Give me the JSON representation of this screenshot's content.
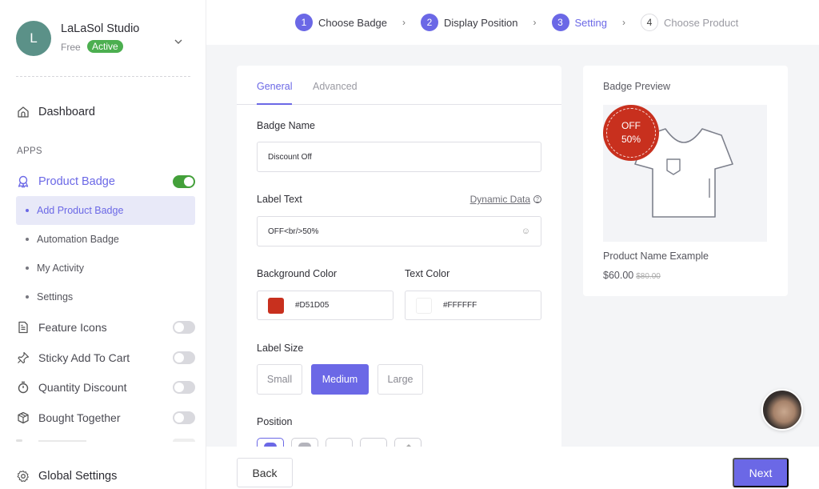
{
  "account": {
    "initial": "L",
    "name": "LaLaSol Studio",
    "plan": "Free",
    "status": "Active"
  },
  "sidebar": {
    "dashboard": "Dashboard",
    "apps_heading": "APPS",
    "product_badge": {
      "label": "Product Badge",
      "enabled": true
    },
    "sub_items": [
      {
        "label": "Add Product Badge",
        "active": true
      },
      {
        "label": "Automation Badge",
        "active": false
      },
      {
        "label": "My Activity",
        "active": false
      },
      {
        "label": "Settings",
        "active": false
      }
    ],
    "apps": [
      {
        "label": "Feature Icons",
        "icon": "file-icon",
        "enabled": false
      },
      {
        "label": "Sticky Add To Cart",
        "icon": "pin-icon",
        "enabled": false
      },
      {
        "label": "Quantity Discount",
        "icon": "stopwatch-icon",
        "enabled": false
      },
      {
        "label": "Bought Together",
        "icon": "box-icon",
        "enabled": false
      }
    ],
    "global_settings": "Global Settings"
  },
  "stepper": {
    "steps": [
      {
        "num": "1",
        "label": "Choose Badge",
        "state": "done"
      },
      {
        "num": "2",
        "label": "Display Position",
        "state": "done"
      },
      {
        "num": "3",
        "label": "Setting",
        "state": "current"
      },
      {
        "num": "4",
        "label": "Choose Product",
        "state": "pending"
      }
    ],
    "separator": "›"
  },
  "settings": {
    "tabs": {
      "general": "General",
      "advanced": "Advanced",
      "active": "General"
    },
    "badge_name": {
      "label": "Badge Name",
      "value": "Discount Off"
    },
    "label_text": {
      "label": "Label Text",
      "value": "OFF<br/>50%",
      "dynamic_link": "Dynamic Data",
      "help": "?",
      "emoji": "☺"
    },
    "background_color": {
      "label": "Background Color",
      "value": "#D51D05",
      "swatch": "#c8301e"
    },
    "text_color": {
      "label": "Text Color",
      "value": "#FFFFFF",
      "swatch": "#ffffff"
    },
    "label_size": {
      "label": "Label Size",
      "options": [
        "Small",
        "Medium",
        "Large"
      ],
      "selected": "Medium"
    },
    "position": {
      "label": "Position",
      "selected_index": 0
    }
  },
  "preview": {
    "title": "Badge Preview",
    "badge_line1": "OFF",
    "badge_line2": "50%",
    "badge_bg": "#c8301e",
    "badge_fg": "#ffffff",
    "product_name": "Product Name Example",
    "price": "$60.00",
    "old_price": "$80.00"
  },
  "footer": {
    "back": "Back",
    "next": "Next"
  },
  "colors": {
    "accent": "#6b68e6",
    "toggle_on": "#43a03a",
    "active_badge": "#4caf50"
  }
}
